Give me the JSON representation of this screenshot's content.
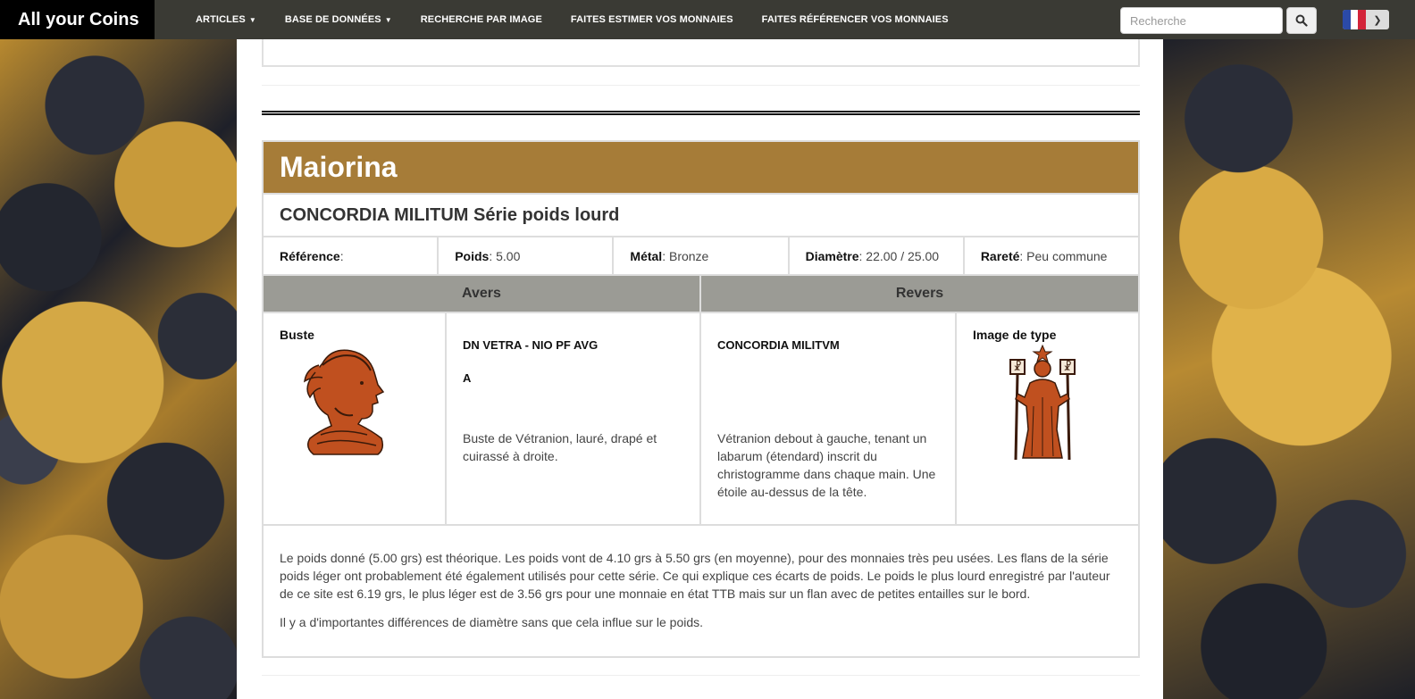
{
  "navbar": {
    "brand": "All your Coins",
    "items": [
      {
        "label": "ARTICLES",
        "dropdown": true
      },
      {
        "label": "BASE DE DONNÉES",
        "dropdown": true
      },
      {
        "label": "RECHERCHE PAR IMAGE",
        "dropdown": false
      },
      {
        "label": "FAITES ESTIMER VOS MONNAIES",
        "dropdown": false
      },
      {
        "label": "FAITES RÉFÉRENCER VOS MONNAIES",
        "dropdown": false
      }
    ],
    "search_placeholder": "Recherche",
    "search_icon": "search-icon",
    "language_flag": "france-flag-icon"
  },
  "card": {
    "title": "Maiorina",
    "subtitle": "CONCORDIA MILITUM Série poids lourd",
    "properties": {
      "reference_label": "Référence",
      "reference_value": " :",
      "weight_label": "Poids",
      "weight_value": ": 5.00",
      "metal_label": "Métal",
      "metal_value": ": Bronze",
      "diameter_label": "Diamètre",
      "diameter_value": ": 22.00 / 25.00",
      "rarity_label": "Rareté",
      "rarity_value": ": Peu commune"
    },
    "sides": {
      "avers": "Avers",
      "revers": "Revers"
    },
    "obverse": {
      "image_label": "Buste",
      "legend": "DN VETRA - NIO PF AVG",
      "field": "A",
      "description": "Buste de Vétranion, lauré, drapé et cuirassé à droite."
    },
    "reverse": {
      "legend": "CONCORDIA MILITVM",
      "description": "Vétranion debout à gauche, tenant un labarum (étendard) inscrit du christogramme dans chaque main. Une étoile au-dessus de la tête.",
      "image_label": "Image de type"
    },
    "notes": [
      "Le poids donné (5.00 grs) est théorique. Les poids vont de 4.10 grs à 5.50 grs (en moyenne), pour des monnaies très peu usées. Les flans de la série poids léger ont probablement été également utilisés pour cette série. Ce qui explique ces écarts de poids. Le poids le plus lourd enregistré par l'auteur de ce site est 6.19 grs, le plus léger est de 3.56 grs pour une monnaie en état TTB mais sur un flan avec de petites entailles sur le bord.",
      "Il y a d'importantes différences de diamètre sans que cela influe sur le poids."
    ]
  },
  "colors": {
    "navbar_bg": "#3a3a34",
    "brand_bg": "#000000",
    "card_title_bg": "#a67c38",
    "sides_header_bg": "#9b9b95",
    "illustration_color": "#c0501f"
  }
}
